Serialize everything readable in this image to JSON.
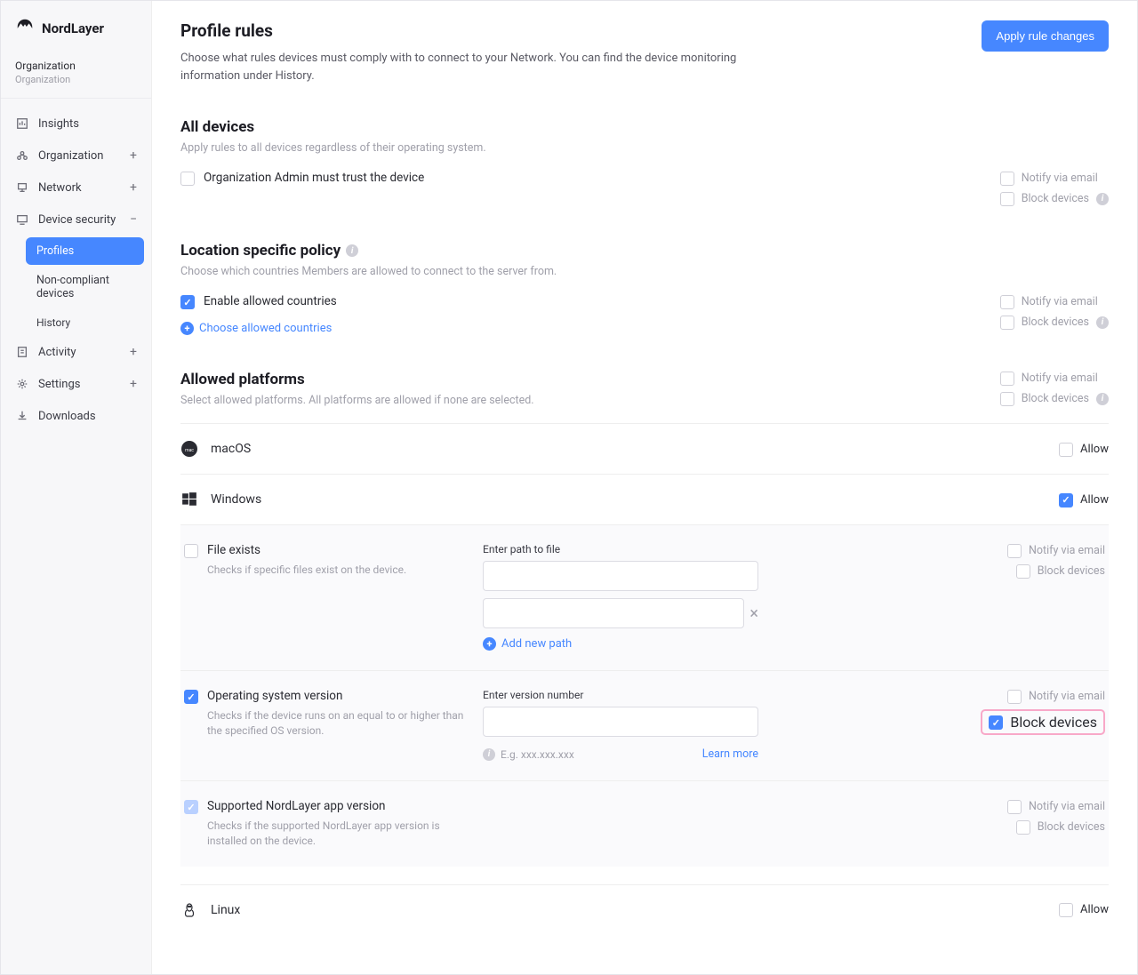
{
  "brand": "NordLayer",
  "org": {
    "label": "Organization",
    "name": "Organization"
  },
  "nav": {
    "insights": "Insights",
    "organization": "Organization",
    "network": "Network",
    "device_security": "Device security",
    "profiles": "Profiles",
    "non_compliant": "Non-compliant devices",
    "history": "History",
    "activity": "Activity",
    "settings": "Settings",
    "downloads": "Downloads"
  },
  "header": {
    "title": "Profile rules",
    "subtitle": "Choose what rules devices must comply with to connect to your Network. You can find the device monitoring information under History.",
    "apply_btn": "Apply rule changes"
  },
  "all_devices": {
    "title": "All devices",
    "subtitle": "Apply rules to all devices regardless of their operating system.",
    "admin_trust": "Organization Admin must trust the device",
    "notify": "Notify via email",
    "block": "Block devices"
  },
  "location": {
    "title": "Location specific policy",
    "subtitle": "Choose which countries Members are allowed to connect to the server from.",
    "enable": "Enable allowed countries",
    "choose": "Choose allowed countries",
    "notify": "Notify via email",
    "block": "Block devices"
  },
  "platforms": {
    "title": "Allowed platforms",
    "subtitle": "Select allowed platforms. All platforms are allowed if none are selected.",
    "notify": "Notify via email",
    "block": "Block devices",
    "allow": "Allow",
    "macos": "macOS",
    "windows": "Windows",
    "linux": "Linux"
  },
  "rules": {
    "file": {
      "label": "File exists",
      "desc": "Checks if specific files exist on the device.",
      "input_label": "Enter path to file",
      "add_path": "Add new path",
      "notify": "Notify via email",
      "block": "Block devices"
    },
    "os": {
      "label": "Operating system version",
      "desc": "Checks if the device runs on an equal to or higher than the specified OS version.",
      "input_label": "Enter version number",
      "placeholder": "E.g. xxx.xxx.xxx",
      "learn_more": "Learn more",
      "notify": "Notify via email",
      "block": "Block devices"
    },
    "app": {
      "label": "Supported NordLayer app version",
      "desc": "Checks if the supported NordLayer app version is installed on the device.",
      "notify": "Notify via email",
      "block": "Block devices"
    }
  }
}
